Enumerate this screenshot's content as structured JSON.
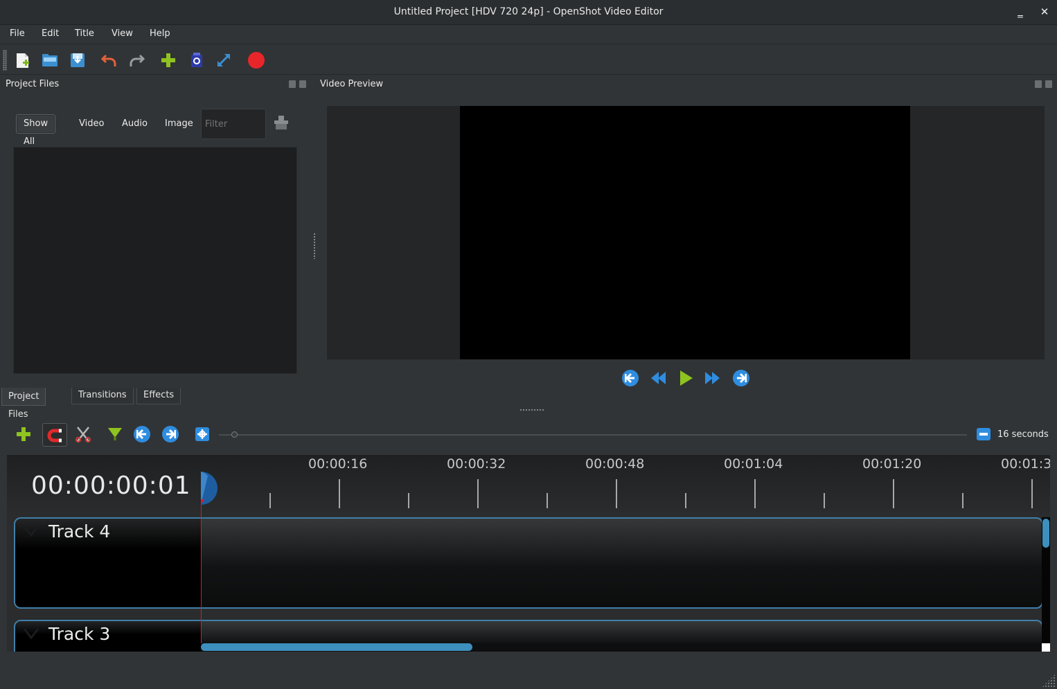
{
  "window": {
    "title": "Untitled Project [HDV 720 24p] - OpenShot Video Editor",
    "minimize_glyph": "‗",
    "close_glyph": "✕"
  },
  "menu": {
    "items": [
      "File",
      "Edit",
      "Title",
      "View",
      "Help"
    ]
  },
  "toolbar": {
    "icons": [
      "new-project-icon",
      "open-project-icon",
      "save-project-icon",
      "undo-icon",
      "redo-icon",
      "import-files-icon",
      "choose-profile-icon",
      "fullscreen-icon",
      "export-video-icon"
    ]
  },
  "project_files": {
    "title": "Project Files",
    "filters": [
      "Show All",
      "Video",
      "Audio",
      "Image"
    ],
    "active_filter": "Show All",
    "filter_placeholder": "Filter"
  },
  "bottom_tabs": {
    "items": [
      "Project Files",
      "Transitions",
      "Effects"
    ],
    "active": "Project Files"
  },
  "video_preview": {
    "title": "Video Preview"
  },
  "timeline": {
    "zoom_label": "16 seconds",
    "current_time": "00:00:00:01",
    "ruler_labels": [
      "00:00:16",
      "00:00:32",
      "00:00:48",
      "00:01:04",
      "00:01:20",
      "00:01:3"
    ],
    "tracks": [
      {
        "name": "Track 4"
      },
      {
        "name": "Track 3"
      }
    ]
  },
  "colors": {
    "background": "#313436",
    "accent_blue": "#3d8fbd",
    "track_border": "#3f7fa8",
    "playhead": "#d81c36",
    "record_red": "#e8262a",
    "add_green": "#8fc31f"
  }
}
